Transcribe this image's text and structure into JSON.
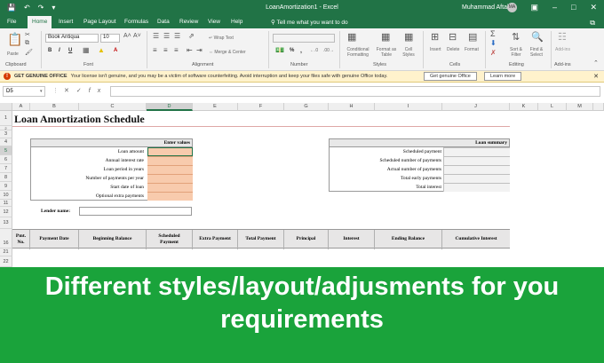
{
  "window": {
    "title": "LoanAmortization1 - Excel",
    "user": "Muhammad Aftab",
    "avatar_initials": "MA"
  },
  "menu": {
    "tabs": [
      "File",
      "Home",
      "Insert",
      "Page Layout",
      "Formulas",
      "Data",
      "Review",
      "View",
      "Help"
    ],
    "active": "Home",
    "tell_me": "Tell me what you want to do"
  },
  "ribbon": {
    "paste": "Paste",
    "font_name": "Book Antiqua",
    "font_size": "10",
    "wrap_text": "Wrap Text",
    "merge_center": "Merge & Center",
    "conditional_formatting": "Conditional Formatting",
    "format_as_table": "Format as Table",
    "cell_styles": "Cell Styles",
    "insert": "Insert",
    "delete": "Delete",
    "format": "Format",
    "sort_filter": "Sort & Filter",
    "find_select": "Find & Select",
    "add_ins": "Add-ins",
    "groups": {
      "clipboard": "Clipboard",
      "font": "Font",
      "alignment": "Alignment",
      "number": "Number",
      "styles": "Styles",
      "cells": "Cells",
      "editing": "Editing",
      "add_ins": "Add-ins"
    }
  },
  "notice": {
    "title": "GET GENUINE OFFICE",
    "message": "Your license isn't genuine, and you may be a victim of software counterfeiting. Avoid interruption and keep your files safe with genuine Office today.",
    "btn_genuine": "Get genuine Office",
    "btn_learn": "Learn more"
  },
  "formula_bar": {
    "cell_ref": "D5",
    "value": ""
  },
  "columns": [
    "A",
    "B",
    "C",
    "D",
    "E",
    "F",
    "G",
    "H",
    "I",
    "J",
    "K",
    "L",
    "M"
  ],
  "rows": [
    "1",
    "2",
    "3",
    "4",
    "5",
    "6",
    "7",
    "8",
    "9",
    "10",
    "11",
    "12",
    "13",
    "16",
    "21",
    "22"
  ],
  "sheet": {
    "title": "Loan Amortization Schedule",
    "enter_values_header": "Enter values",
    "input_labels": [
      "Loan amount",
      "Annual interest rate",
      "Loan period in years",
      "Number of payments per year",
      "Start date of loan",
      "Optional extra payments"
    ],
    "summary_header": "Loan summary",
    "summary_labels": [
      "Scheduled payment",
      "Scheduled number of payments",
      "Actual number of payments",
      "Total early payments",
      "Total interest"
    ],
    "lender_label": "Lender name:",
    "table_headers": [
      "Pmt. No.",
      "Payment Date",
      "Beginning Balance",
      "Scheduled Payment",
      "Extra Payment",
      "Total Payment",
      "Principal",
      "Interest",
      "Ending Balance",
      "Cumulative Interest"
    ]
  },
  "banner": {
    "line1": "Different styles/layout/adjusments for you",
    "line2": "requirements",
    "color": "#1aa33b"
  },
  "colors": {
    "excel_green": "#217346",
    "input_fill": "#f8cbad"
  }
}
